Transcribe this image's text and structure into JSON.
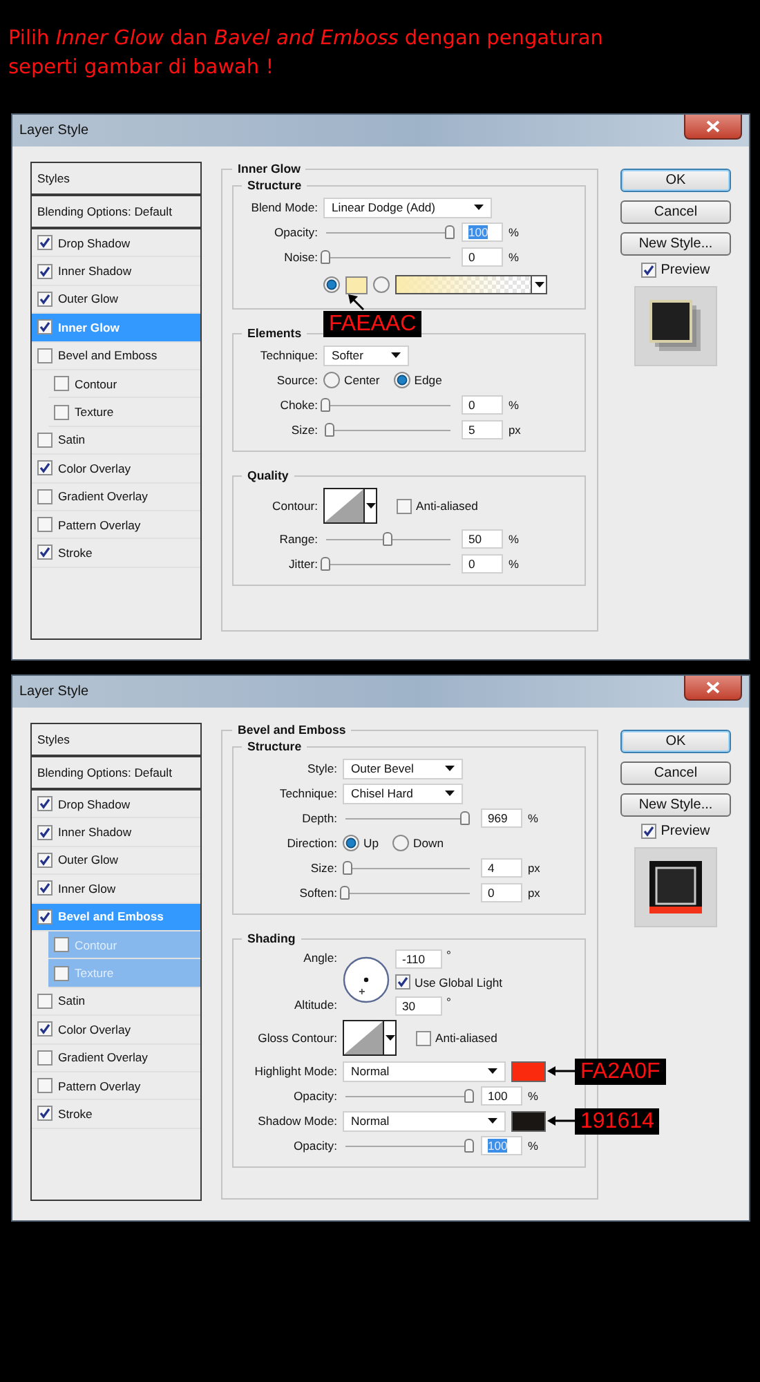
{
  "instruction": "Pilih *Inner Glow* dan *Bavel and Emboss* dengan pengaturan seperti gambar di bawah !",
  "dialogs": [
    {
      "title": "Layer Style",
      "styles": [
        {
          "kind": "header",
          "label": "Styles",
          "selected": false
        },
        {
          "kind": "header",
          "label": "Blending Options: Default",
          "selected": false
        },
        {
          "kind": "effect",
          "label": "Drop Shadow",
          "checked": true,
          "selected": false
        },
        {
          "kind": "effect",
          "label": "Inner Shadow",
          "checked": true,
          "selected": false
        },
        {
          "kind": "effect",
          "label": "Outer Glow",
          "checked": true,
          "selected": false
        },
        {
          "kind": "effect",
          "label": "Inner Glow",
          "checked": true,
          "selected": true
        },
        {
          "kind": "effect",
          "label": "Bevel and Emboss",
          "checked": false,
          "selected": false
        },
        {
          "kind": "sub",
          "label": "Contour",
          "checked": false,
          "selected": false,
          "highlighted": false
        },
        {
          "kind": "sub",
          "label": "Texture",
          "checked": false,
          "selected": false,
          "highlighted": false
        },
        {
          "kind": "effect",
          "label": "Satin",
          "checked": false,
          "selected": false
        },
        {
          "kind": "effect",
          "label": "Color Overlay",
          "checked": true,
          "selected": false
        },
        {
          "kind": "effect",
          "label": "Gradient Overlay",
          "checked": false,
          "selected": false
        },
        {
          "kind": "effect",
          "label": "Pattern Overlay",
          "checked": false,
          "selected": false
        },
        {
          "kind": "effect",
          "label": "Stroke",
          "checked": true,
          "selected": false
        }
      ],
      "panel": {
        "title": "Inner Glow",
        "groups": [
          {
            "title": "Structure",
            "rows": [
              {
                "kind": "dropdown",
                "label": "Blend Mode:",
                "value": "Linear Dodge (Add)"
              },
              {
                "kind": "slider",
                "label": "Opacity:",
                "level": 1,
                "value": "100",
                "unit": "%",
                "text_selected": true
              },
              {
                "kind": "slider",
                "label": "Noise:",
                "level": 0,
                "value": "0",
                "unit": "%",
                "text_selected": false
              },
              {
                "kind": "fill",
                "options": [
                  {
                    "kind": "color",
                    "selected": true,
                    "color": "#faeaac",
                    "callout": "FAEAAC"
                  },
                  {
                    "kind": "gradient",
                    "selected": false,
                    "color": "#faeaac"
                  }
                ]
              }
            ]
          },
          {
            "title": "Elements",
            "rows": [
              {
                "kind": "dropdown",
                "label": "Technique:",
                "value": "Softer"
              },
              {
                "kind": "radio",
                "label": "Source:",
                "options": [
                  {
                    "label": "Center",
                    "selected": false
                  },
                  {
                    "label": "Edge",
                    "selected": true
                  }
                ]
              },
              {
                "kind": "slider",
                "label": "Choke:",
                "level": 0,
                "value": "0",
                "unit": "%",
                "text_selected": false
              },
              {
                "kind": "slider",
                "label": "Size:",
                "level": 0.03,
                "value": "5",
                "unit": "px",
                "text_selected": false
              }
            ]
          },
          {
            "title": "Quality",
            "rows": [
              {
                "kind": "contour",
                "label": "Contour:",
                "checkbox": {
                  "label": "Anti-aliased",
                  "checked": false
                }
              },
              {
                "kind": "slider",
                "label": "Range:",
                "level": 0.5,
                "value": "50",
                "unit": "%",
                "text_selected": false
              },
              {
                "kind": "slider",
                "label": "Jitter:",
                "level": 0,
                "value": "0",
                "unit": "%",
                "text_selected": false
              }
            ]
          }
        ]
      },
      "buttons": [
        {
          "label": "OK",
          "default": true
        },
        {
          "label": "Cancel",
          "default": false
        },
        {
          "label": "New Style...",
          "default": false
        }
      ],
      "preview": {
        "label": "Preview",
        "checked": true,
        "kind": "glow"
      }
    },
    {
      "title": "Layer Style",
      "styles": [
        {
          "kind": "header",
          "label": "Styles",
          "selected": false
        },
        {
          "kind": "header",
          "label": "Blending Options: Default",
          "selected": false
        },
        {
          "kind": "effect",
          "label": "Drop Shadow",
          "checked": true,
          "selected": false
        },
        {
          "kind": "effect",
          "label": "Inner Shadow",
          "checked": true,
          "selected": false
        },
        {
          "kind": "effect",
          "label": "Outer Glow",
          "checked": true,
          "selected": false
        },
        {
          "kind": "effect",
          "label": "Inner Glow",
          "checked": true,
          "selected": false
        },
        {
          "kind": "effect",
          "label": "Bevel and Emboss",
          "checked": true,
          "selected": true
        },
        {
          "kind": "sub",
          "label": "Contour",
          "checked": false,
          "selected": false,
          "highlighted": true
        },
        {
          "kind": "sub",
          "label": "Texture",
          "checked": false,
          "selected": false,
          "highlighted": true
        },
        {
          "kind": "effect",
          "label": "Satin",
          "checked": false,
          "selected": false
        },
        {
          "kind": "effect",
          "label": "Color Overlay",
          "checked": true,
          "selected": false
        },
        {
          "kind": "effect",
          "label": "Gradient Overlay",
          "checked": false,
          "selected": false
        },
        {
          "kind": "effect",
          "label": "Pattern Overlay",
          "checked": false,
          "selected": false
        },
        {
          "kind": "effect",
          "label": "Stroke",
          "checked": true,
          "selected": false
        }
      ],
      "panel": {
        "title": "Bevel and Emboss",
        "groups": [
          {
            "title": "Structure",
            "rows": [
              {
                "kind": "dropdown",
                "label": "Style:",
                "value": "Outer Bevel"
              },
              {
                "kind": "dropdown",
                "label": "Technique:",
                "value": "Chisel Hard"
              },
              {
                "kind": "slider",
                "label": "Depth:",
                "level": 0.97,
                "value": "969",
                "unit": "%",
                "text_selected": false
              },
              {
                "kind": "radio",
                "label": "Direction:",
                "options": [
                  {
                    "label": "Up",
                    "selected": true
                  },
                  {
                    "label": "Down",
                    "selected": false
                  }
                ]
              },
              {
                "kind": "slider",
                "label": "Size:",
                "level": 0.02,
                "value": "4",
                "unit": "px",
                "text_selected": false
              },
              {
                "kind": "slider",
                "label": "Soften:",
                "level": 0,
                "value": "0",
                "unit": "px",
                "text_selected": false
              }
            ]
          },
          {
            "title": "Shading",
            "rows": [
              {
                "kind": "angle",
                "label": "Angle:",
                "value": "-110",
                "unit": "°",
                "checkbox": {
                  "label": "Use Global Light",
                  "checked": true
                },
                "altitude_label": "Altitude:",
                "altitude_value": "30",
                "altitude_unit": "°"
              },
              {
                "kind": "contour",
                "label": "Gloss Contour:",
                "checkbox": {
                  "label": "Anti-aliased",
                  "checked": false
                }
              },
              {
                "kind": "dropdown",
                "label": "Highlight Mode:",
                "value": "Normal",
                "color": "#fa2a0f",
                "callout": "FA2A0F"
              },
              {
                "kind": "slider",
                "label": "Opacity:",
                "level": 1,
                "value": "100",
                "unit": "%",
                "text_selected": false
              },
              {
                "kind": "dropdown",
                "label": "Shadow Mode:",
                "value": "Normal",
                "color": "#191614",
                "callout": "191614"
              },
              {
                "kind": "slider",
                "label": "Opacity:",
                "level": 1,
                "value": "100",
                "unit": "%",
                "text_selected": true
              }
            ]
          }
        ]
      },
      "buttons": [
        {
          "label": "OK",
          "default": true
        },
        {
          "label": "Cancel",
          "default": false
        },
        {
          "label": "New Style...",
          "default": false
        }
      ],
      "preview": {
        "label": "Preview",
        "checked": true,
        "kind": "bevel"
      }
    }
  ]
}
